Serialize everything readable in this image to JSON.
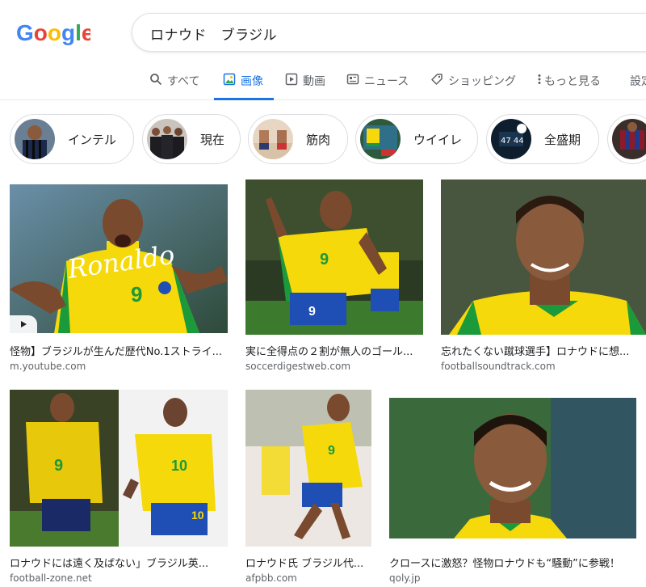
{
  "logo": {
    "text": "Google"
  },
  "search": {
    "query": "ロナウド　ブラジル"
  },
  "tabs": [
    {
      "label": "すべて",
      "icon": "search-icon"
    },
    {
      "label": "画像",
      "icon": "image-icon",
      "active": true
    },
    {
      "label": "動画",
      "icon": "video-icon"
    },
    {
      "label": "ニュース",
      "icon": "news-icon"
    },
    {
      "label": "ショッピング",
      "icon": "tag-icon"
    },
    {
      "label": "もっと見る",
      "icon": "more-vert-icon"
    },
    {
      "label": "設定"
    }
  ],
  "chips": [
    {
      "label": "インテル"
    },
    {
      "label": "現在"
    },
    {
      "label": "筋肉"
    },
    {
      "label": "ウイイレ"
    },
    {
      "label": "全盛期"
    },
    {
      "label": ""
    }
  ],
  "results": [
    {
      "caption": "怪物】ブラジルが生んだ歴代No.1ストライ...",
      "domain": "m.youtube.com",
      "overlay_text": "Ronaldo"
    },
    {
      "caption": "実に全得点の２割が無人のゴール...",
      "domain": "soccerdigestweb.com"
    },
    {
      "caption": "忘れたくない蹴球選手】ロナウドに想...",
      "domain": "footballsoundtrack.com"
    },
    {
      "caption": "ロナウドには遠く及ばない」ブラジル英...",
      "domain": "football-zone.net"
    },
    {
      "caption": "ロナウド氏 ブラジル代...",
      "domain": "afpbb.com"
    },
    {
      "caption": "クロースに激怒？怪物ロナウドも“騒動”に参戦！",
      "domain": "qoly.jp"
    }
  ],
  "colors": {
    "accent": "#1a73e8",
    "brazil_yellow": "#f5d90a",
    "brazil_green": "#1a9a3a",
    "brazil_blue": "#1f4fb5"
  }
}
